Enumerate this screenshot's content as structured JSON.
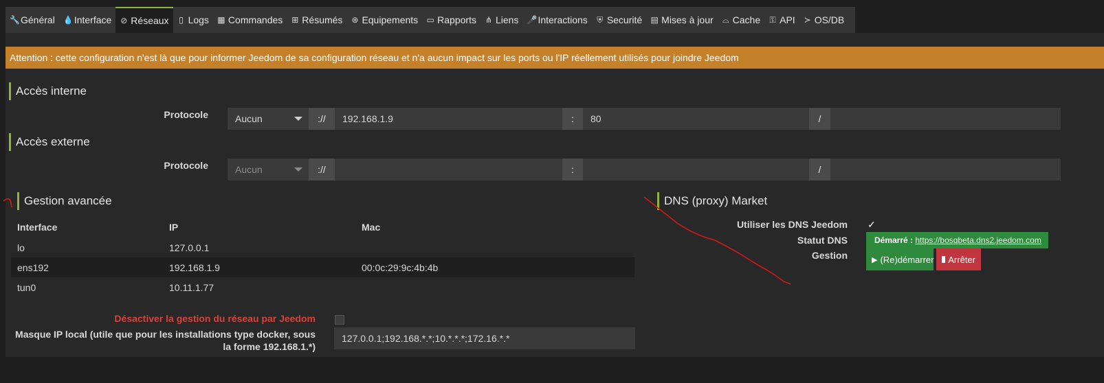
{
  "tabs": [
    {
      "label": "Général",
      "icon": "wrench-icon",
      "glyph": "🔧"
    },
    {
      "label": "Interface",
      "icon": "drop-icon",
      "glyph": "💧"
    },
    {
      "label": "Réseaux",
      "icon": "rss-icon",
      "glyph": "⊘",
      "active": true
    },
    {
      "label": "Logs",
      "icon": "file-icon",
      "glyph": "▯"
    },
    {
      "label": "Commandes",
      "icon": "table-icon",
      "glyph": "▦"
    },
    {
      "label": "Résumés",
      "icon": "grid-icon",
      "glyph": "⊞"
    },
    {
      "label": "Equipements",
      "icon": "cubes-icon",
      "glyph": "⊛"
    },
    {
      "label": "Rapports",
      "icon": "report-icon",
      "glyph": "▭"
    },
    {
      "label": "Liens",
      "icon": "sitemap-icon",
      "glyph": "⋔"
    },
    {
      "label": "Interactions",
      "icon": "microphone-icon",
      "glyph": "🎤"
    },
    {
      "label": "Securité",
      "icon": "shield-icon",
      "glyph": "⛨"
    },
    {
      "label": "Mises à jour",
      "icon": "server-icon",
      "glyph": "▤"
    },
    {
      "label": "Cache",
      "icon": "drive-icon",
      "glyph": "⌓"
    },
    {
      "label": "API",
      "icon": "key-icon",
      "glyph": "⚿"
    },
    {
      "label": "OS/DB",
      "icon": "terminal-icon",
      "glyph": "≻"
    }
  ],
  "alert": "Attention : cette configuration n'est là que pour informer Jeedom de sa configuration réseau et n'a aucun impact sur les ports ou l'IP réellement utilisés pour joindre Jeedom",
  "internal": {
    "title": "Accès interne",
    "protocol_label": "Protocole",
    "protocol_value": "Aucun",
    "scheme_sep": "://",
    "host": "192.168.1.9",
    "port_sep": ":",
    "port": "80",
    "path_sep": "/",
    "path": ""
  },
  "external": {
    "title": "Accès externe",
    "protocol_label": "Protocole",
    "protocol_value": "Aucun",
    "scheme_sep": "://",
    "host": "",
    "port_sep": ":",
    "port": "",
    "path_sep": "/",
    "path": ""
  },
  "advanced": {
    "title": "Gestion avancée",
    "headers": [
      "Interface",
      "IP",
      "Mac"
    ],
    "rows": [
      [
        "lo",
        "127.0.0.1",
        ""
      ],
      [
        "ens192",
        "192.168.1.9",
        "00:0c:29:9c:4b:4b"
      ],
      [
        "tun0",
        "10.11.1.77",
        ""
      ]
    ],
    "disable_label": "Désactiver la gestion du réseau par Jeedom",
    "disable_color": "#d9423a",
    "mask_label": "Masque IP local (utile que pour les installations type docker, sous la forme 192.168.1.*)",
    "mask_value": "127.0.0.1;192.168.*.*;10.*.*.*;172.16.*.*"
  },
  "dns": {
    "title": "DNS (proxy) Market",
    "use_label": "Utiliser les DNS Jeedom",
    "use_checked": "✓",
    "status_label": "Statut DNS",
    "status_prefix": "Démarré :",
    "status_link": "https://bosqbeta.dns2.jeedom.com",
    "manage_label": "Gestion",
    "restart_label": "(Re)démarrer",
    "stop_label": "Arrêter"
  },
  "colors": {
    "accent": "#93b53b",
    "alert": "#c5802a",
    "success": "#2e8b3d",
    "danger": "#c1353f"
  }
}
